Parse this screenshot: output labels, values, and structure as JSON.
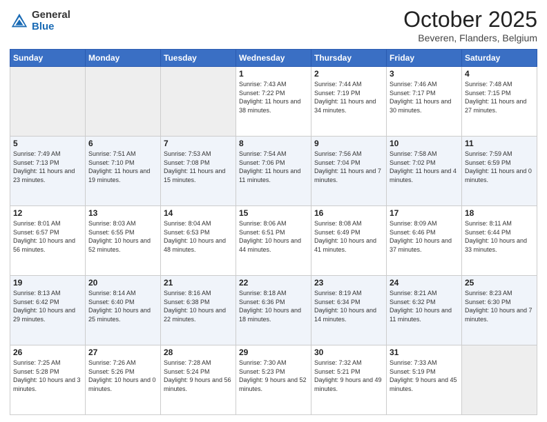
{
  "header": {
    "logo_general": "General",
    "logo_blue": "Blue",
    "month_title": "October 2025",
    "location": "Beveren, Flanders, Belgium"
  },
  "weekdays": [
    "Sunday",
    "Monday",
    "Tuesday",
    "Wednesday",
    "Thursday",
    "Friday",
    "Saturday"
  ],
  "weeks": [
    [
      {
        "day": "",
        "sunrise": "",
        "sunset": "",
        "daylight": ""
      },
      {
        "day": "",
        "sunrise": "",
        "sunset": "",
        "daylight": ""
      },
      {
        "day": "",
        "sunrise": "",
        "sunset": "",
        "daylight": ""
      },
      {
        "day": "1",
        "sunrise": "Sunrise: 7:43 AM",
        "sunset": "Sunset: 7:22 PM",
        "daylight": "Daylight: 11 hours and 38 minutes."
      },
      {
        "day": "2",
        "sunrise": "Sunrise: 7:44 AM",
        "sunset": "Sunset: 7:19 PM",
        "daylight": "Daylight: 11 hours and 34 minutes."
      },
      {
        "day": "3",
        "sunrise": "Sunrise: 7:46 AM",
        "sunset": "Sunset: 7:17 PM",
        "daylight": "Daylight: 11 hours and 30 minutes."
      },
      {
        "day": "4",
        "sunrise": "Sunrise: 7:48 AM",
        "sunset": "Sunset: 7:15 PM",
        "daylight": "Daylight: 11 hours and 27 minutes."
      }
    ],
    [
      {
        "day": "5",
        "sunrise": "Sunrise: 7:49 AM",
        "sunset": "Sunset: 7:13 PM",
        "daylight": "Daylight: 11 hours and 23 minutes."
      },
      {
        "day": "6",
        "sunrise": "Sunrise: 7:51 AM",
        "sunset": "Sunset: 7:10 PM",
        "daylight": "Daylight: 11 hours and 19 minutes."
      },
      {
        "day": "7",
        "sunrise": "Sunrise: 7:53 AM",
        "sunset": "Sunset: 7:08 PM",
        "daylight": "Daylight: 11 hours and 15 minutes."
      },
      {
        "day": "8",
        "sunrise": "Sunrise: 7:54 AM",
        "sunset": "Sunset: 7:06 PM",
        "daylight": "Daylight: 11 hours and 11 minutes."
      },
      {
        "day": "9",
        "sunrise": "Sunrise: 7:56 AM",
        "sunset": "Sunset: 7:04 PM",
        "daylight": "Daylight: 11 hours and 7 minutes."
      },
      {
        "day": "10",
        "sunrise": "Sunrise: 7:58 AM",
        "sunset": "Sunset: 7:02 PM",
        "daylight": "Daylight: 11 hours and 4 minutes."
      },
      {
        "day": "11",
        "sunrise": "Sunrise: 7:59 AM",
        "sunset": "Sunset: 6:59 PM",
        "daylight": "Daylight: 11 hours and 0 minutes."
      }
    ],
    [
      {
        "day": "12",
        "sunrise": "Sunrise: 8:01 AM",
        "sunset": "Sunset: 6:57 PM",
        "daylight": "Daylight: 10 hours and 56 minutes."
      },
      {
        "day": "13",
        "sunrise": "Sunrise: 8:03 AM",
        "sunset": "Sunset: 6:55 PM",
        "daylight": "Daylight: 10 hours and 52 minutes."
      },
      {
        "day": "14",
        "sunrise": "Sunrise: 8:04 AM",
        "sunset": "Sunset: 6:53 PM",
        "daylight": "Daylight: 10 hours and 48 minutes."
      },
      {
        "day": "15",
        "sunrise": "Sunrise: 8:06 AM",
        "sunset": "Sunset: 6:51 PM",
        "daylight": "Daylight: 10 hours and 44 minutes."
      },
      {
        "day": "16",
        "sunrise": "Sunrise: 8:08 AM",
        "sunset": "Sunset: 6:49 PM",
        "daylight": "Daylight: 10 hours and 41 minutes."
      },
      {
        "day": "17",
        "sunrise": "Sunrise: 8:09 AM",
        "sunset": "Sunset: 6:46 PM",
        "daylight": "Daylight: 10 hours and 37 minutes."
      },
      {
        "day": "18",
        "sunrise": "Sunrise: 8:11 AM",
        "sunset": "Sunset: 6:44 PM",
        "daylight": "Daylight: 10 hours and 33 minutes."
      }
    ],
    [
      {
        "day": "19",
        "sunrise": "Sunrise: 8:13 AM",
        "sunset": "Sunset: 6:42 PM",
        "daylight": "Daylight: 10 hours and 29 minutes."
      },
      {
        "day": "20",
        "sunrise": "Sunrise: 8:14 AM",
        "sunset": "Sunset: 6:40 PM",
        "daylight": "Daylight: 10 hours and 25 minutes."
      },
      {
        "day": "21",
        "sunrise": "Sunrise: 8:16 AM",
        "sunset": "Sunset: 6:38 PM",
        "daylight": "Daylight: 10 hours and 22 minutes."
      },
      {
        "day": "22",
        "sunrise": "Sunrise: 8:18 AM",
        "sunset": "Sunset: 6:36 PM",
        "daylight": "Daylight: 10 hours and 18 minutes."
      },
      {
        "day": "23",
        "sunrise": "Sunrise: 8:19 AM",
        "sunset": "Sunset: 6:34 PM",
        "daylight": "Daylight: 10 hours and 14 minutes."
      },
      {
        "day": "24",
        "sunrise": "Sunrise: 8:21 AM",
        "sunset": "Sunset: 6:32 PM",
        "daylight": "Daylight: 10 hours and 11 minutes."
      },
      {
        "day": "25",
        "sunrise": "Sunrise: 8:23 AM",
        "sunset": "Sunset: 6:30 PM",
        "daylight": "Daylight: 10 hours and 7 minutes."
      }
    ],
    [
      {
        "day": "26",
        "sunrise": "Sunrise: 7:25 AM",
        "sunset": "Sunset: 5:28 PM",
        "daylight": "Daylight: 10 hours and 3 minutes."
      },
      {
        "day": "27",
        "sunrise": "Sunrise: 7:26 AM",
        "sunset": "Sunset: 5:26 PM",
        "daylight": "Daylight: 10 hours and 0 minutes."
      },
      {
        "day": "28",
        "sunrise": "Sunrise: 7:28 AM",
        "sunset": "Sunset: 5:24 PM",
        "daylight": "Daylight: 9 hours and 56 minutes."
      },
      {
        "day": "29",
        "sunrise": "Sunrise: 7:30 AM",
        "sunset": "Sunset: 5:23 PM",
        "daylight": "Daylight: 9 hours and 52 minutes."
      },
      {
        "day": "30",
        "sunrise": "Sunrise: 7:32 AM",
        "sunset": "Sunset: 5:21 PM",
        "daylight": "Daylight: 9 hours and 49 minutes."
      },
      {
        "day": "31",
        "sunrise": "Sunrise: 7:33 AM",
        "sunset": "Sunset: 5:19 PM",
        "daylight": "Daylight: 9 hours and 45 minutes."
      },
      {
        "day": "",
        "sunrise": "",
        "sunset": "",
        "daylight": ""
      }
    ]
  ]
}
